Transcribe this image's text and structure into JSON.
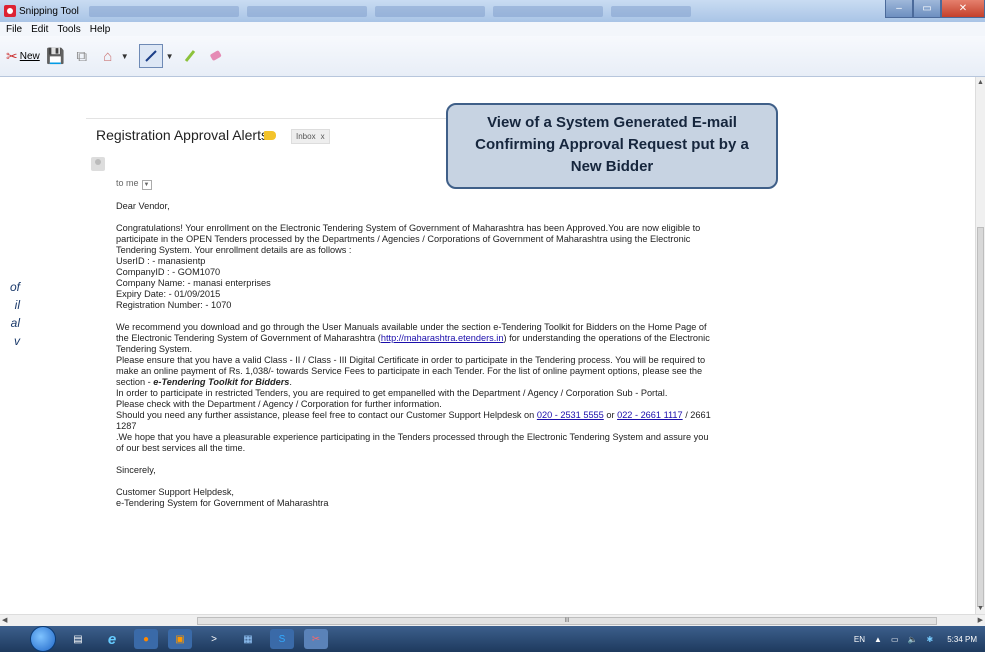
{
  "window": {
    "app_title": "Snipping Tool",
    "controls": {
      "minimize": "–",
      "maximize": "▭",
      "close": "✕"
    }
  },
  "menu": [
    "File",
    "Edit",
    "Tools",
    "Help"
  ],
  "toolbar": {
    "new_label": "New"
  },
  "side_note_lines": [
    "of",
    "il",
    "al",
    "v"
  ],
  "email": {
    "subject": "Registration Approval Alerts",
    "inbox_label": "Inbox",
    "inbox_close": "x",
    "to_me": "to me",
    "greeting": "Dear Vendor,",
    "intro": "Congratulations! Your enrollment on the Electronic Tendering System of Government of Maharashtra has been Approved.You are now eligible to participate in the OPEN Tenders processed by the Departments / Agencies / Corporations of Government of Maharashtra using the Electronic Tendering System. Your enrollment details are as follows :",
    "details": [
      "UserID : - manasientp",
      "CompanyID : - GOM1070",
      "Company Name: - manasi enterprises",
      "Expiry Date: - 01/09/2015",
      "Registration Number: - 1070"
    ],
    "recommend_before": "We recommend you download and go through the User Manuals available under the section e-Tendering Toolkit for Bidders on the Home Page of the Electronic Tendering System of Government of Maharashtra (",
    "recommend_link": "http://maharashtra.etenders.in",
    "recommend_after": ") for understanding the operations of the Electronic Tendering System.",
    "certificate": "Please ensure that you have a valid Class - II / Class - III Digital Certificate in order to participate in the Tendering process. You will be required to make an online payment of Rs. 1,038/- towards Service Fees to participate in each Tender. For the list of online payment options, please see the section -",
    "toolkit_label": "e-Tendering Toolkit for Bidders",
    "restricted_1": "In order to participate in restricted Tenders, you are required to get empanelled with the Department / Agency / Corporation Sub - Portal.",
    "restricted_2": "Please check with the Department / Agency / Corporation for further information.",
    "assist_before": "Should you need any further assistance, please feel free to contact our Customer Support Helpdesk on",
    "phone_1": "020 - 2531 5555",
    "or": "or",
    "phone_2": "022 - 2661 1117",
    "assist_after": "/ 2661 1287",
    "hope": ".We hope that you have a pleasurable experience participating in the Tenders processed through the Electronic Tendering System and assure you of our best services all the time.",
    "signoff": "Sincerely,",
    "signature_1": "Customer Support Helpdesk,",
    "signature_2": "e-Tendering System for Government of Maharashtra"
  },
  "callout": {
    "line1": "View of a System Generated E-mail",
    "line2": "Confirming Approval Request put by a",
    "line3": "New Bidder"
  },
  "hscroll_label": "III",
  "tray": {
    "lang": "EN",
    "time": "5:34 PM"
  }
}
